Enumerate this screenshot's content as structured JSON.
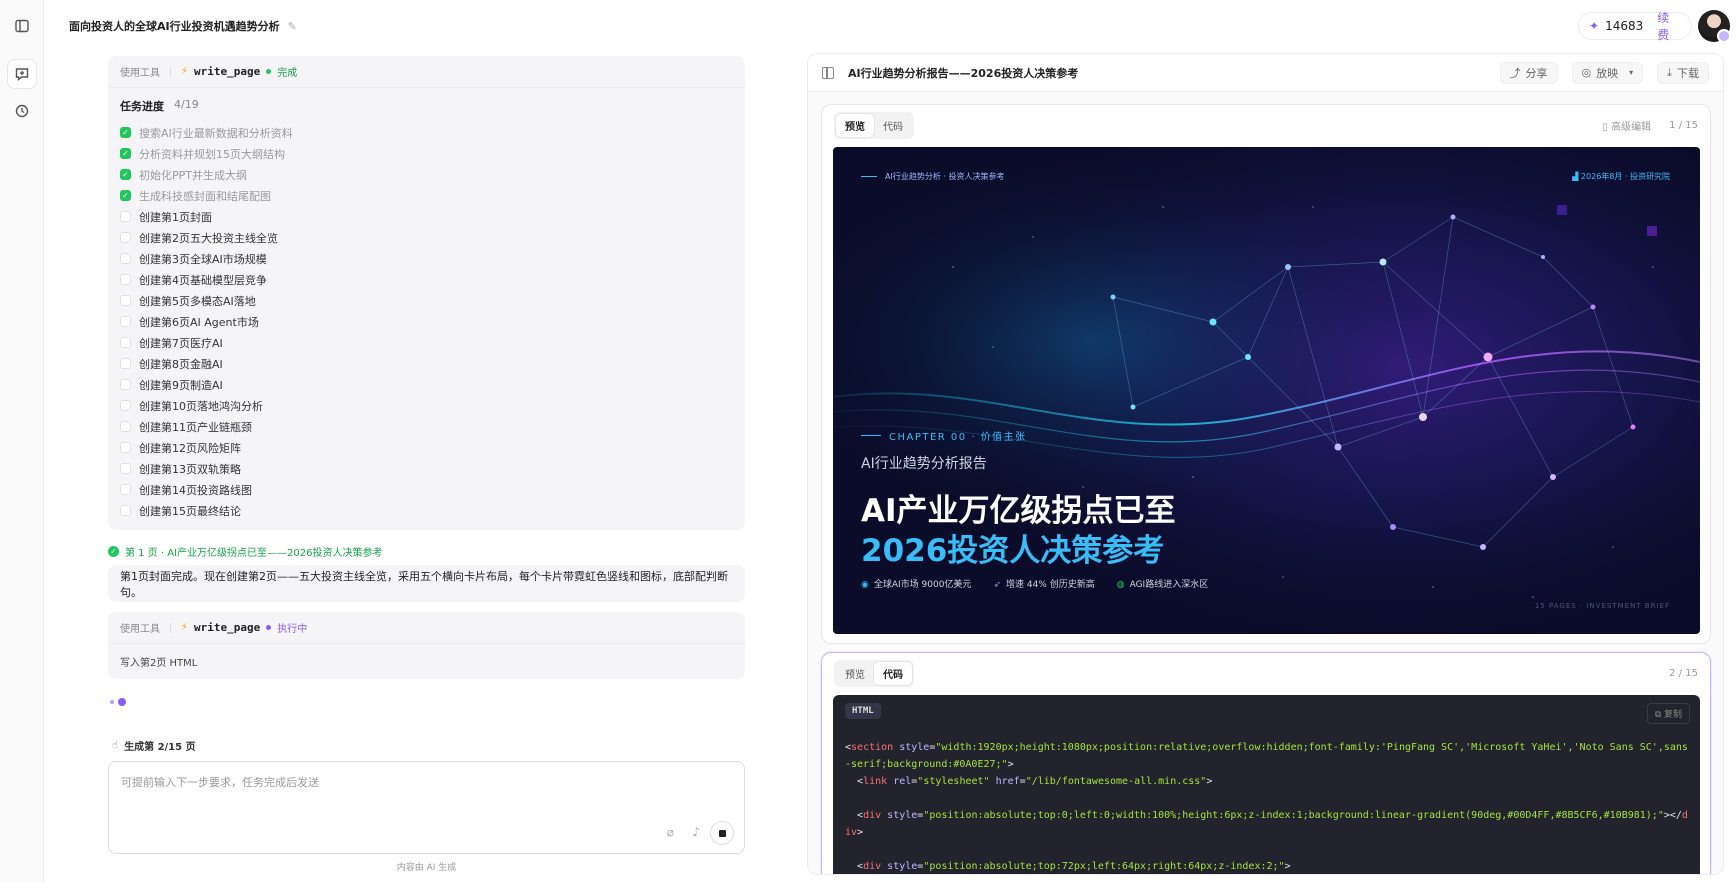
{
  "header": {
    "title": "面向投资人的全球AI行业投资机遇趋势分析",
    "credits": "14683",
    "renew_label": "续费"
  },
  "chat": {
    "tool1": {
      "label": "使用工具",
      "name": "write_page",
      "status": "完成"
    },
    "progress": {
      "label": "任务进度",
      "count": "4/19"
    },
    "tasks": [
      {
        "text": "搜索AI行业最新数据和分析资料",
        "done": true
      },
      {
        "text": "分析资料并规划15页大纲结构",
        "done": true
      },
      {
        "text": "初始化PPT并生成大纲",
        "done": true
      },
      {
        "text": "生成科技感封面和结尾配图",
        "done": true
      },
      {
        "text": "创建第1页封面",
        "done": false
      },
      {
        "text": "创建第2页五大投资主线全览",
        "done": false
      },
      {
        "text": "创建第3页全球AI市场规模",
        "done": false
      },
      {
        "text": "创建第4页基础模型层竞争",
        "done": false
      },
      {
        "text": "创建第5页多模态AI落地",
        "done": false
      },
      {
        "text": "创建第6页AI Agent市场",
        "done": false
      },
      {
        "text": "创建第7页医疗AI",
        "done": false
      },
      {
        "text": "创建第8页金融AI",
        "done": false
      },
      {
        "text": "创建第9页制造AI",
        "done": false
      },
      {
        "text": "创建第10页落地鸿沟分析",
        "done": false
      },
      {
        "text": "创建第11页产业链瓶颈",
        "done": false
      },
      {
        "text": "创建第12页风险矩阵",
        "done": false
      },
      {
        "text": "创建第13页双轨策略",
        "done": false
      },
      {
        "text": "创建第14页投资路线图",
        "done": false
      },
      {
        "text": "创建第15页最终结论",
        "done": false
      }
    ],
    "page_done": "第 1 页 · AI产业万亿级拐点已至——2026投资人决策参考",
    "message": "第1页封面完成。现在创建第2页——五大投资主线全览，采用五个横向卡片布局，每个卡片带霓虹色竖线和图标，底部配判断句。",
    "tool2": {
      "label": "使用工具",
      "name": "write_page",
      "status": "执行中",
      "detail": "写入第2页 HTML"
    },
    "generating": "生成第 2/15 页",
    "input_placeholder": "可提前输入下一步要求，任务完成后发送",
    "ai_note": "内容由 AI 生成"
  },
  "panel": {
    "title": "AI行业趋势分析报告——2026投资人决策参考",
    "share": "分享",
    "present": "放映",
    "download": "下载",
    "card1": {
      "tab_preview": "预览",
      "tab_code": "代码",
      "advanced": "高级编辑",
      "page": "1 / 15"
    },
    "card2": {
      "tab_preview": "预览",
      "tab_code": "代码",
      "page": "2 / 15"
    },
    "slide": {
      "top_left": "AI行业趋势分析 · 投资人决策参考",
      "top_right": "2026年8月 · 投资研究院",
      "chapter": "CHAPTER 00 · 价值主张",
      "subtitle": "AI行业趋势分析报告",
      "headline1": "AI产业万亿级拐点已至",
      "headline2": "2026投资人决策参考",
      "stat1": "全球AI市场 9000亿美元",
      "stat2": "增速 44% 创历史新高",
      "stat3": "AGI路线进入深水区",
      "footer": "15 PAGES · INVESTMENT BRIEF"
    },
    "code": {
      "lang": "HTML",
      "copy": "复制",
      "line1": "<section style=\"width:1920px;height:1080px;position:relative;overflow:hidden;font-family:'PingFang SC','Microsoft YaHei','Noto Sans SC',sans-serif;background:#0A0E27;\">",
      "line2": "  <link rel=\"stylesheet\" href=\"/lib/fontawesome-all.min.css\">",
      "line3": "  <div style=\"position:absolute;top:0;left:0;width:100%;height:6px;z-index:1;background:linear-gradient(90deg,#00D4FF,#8B5CF6,#10B981);\"></div>",
      "line4": "  <div style=\"position:absolute;top:72px;left:64px;right:64px;z-index:2;\">"
    }
  },
  "colors": {
    "accent": "#8b5cf6",
    "success": "#22c55e",
    "slide_bg": "#0b0c2a",
    "slide_cyan": "#38bdf8"
  }
}
